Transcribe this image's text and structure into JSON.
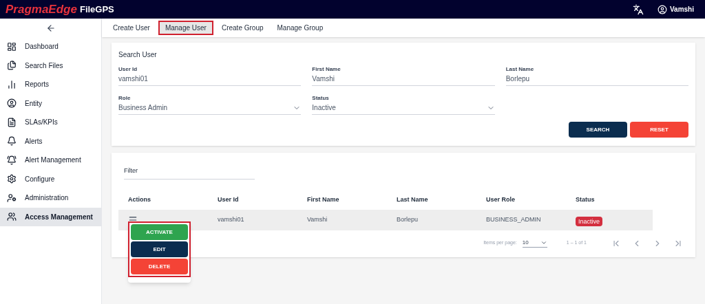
{
  "header": {
    "brand": "PragmaEdge",
    "product": "FileGPS",
    "user": "Vamshi"
  },
  "sidebar": {
    "items": [
      {
        "label": "Dashboard",
        "selected": false
      },
      {
        "label": "Search Files",
        "selected": false
      },
      {
        "label": "Reports",
        "selected": false
      },
      {
        "label": "Entity",
        "selected": false
      },
      {
        "label": "SLAs/KPIs",
        "selected": false
      },
      {
        "label": "Alerts",
        "selected": false
      },
      {
        "label": "Alert Management",
        "selected": false
      },
      {
        "label": "Configure",
        "selected": false
      },
      {
        "label": "Administration",
        "selected": false
      },
      {
        "label": "Access Management",
        "selected": true
      }
    ]
  },
  "tabs": [
    {
      "label": "Create User",
      "selected": false
    },
    {
      "label": "Manage User",
      "selected": true
    },
    {
      "label": "Create Group",
      "selected": false
    },
    {
      "label": "Manage Group",
      "selected": false
    }
  ],
  "search": {
    "title": "Search User",
    "fields": [
      {
        "kind": "text",
        "label": "User Id",
        "value": "vamshi01"
      },
      {
        "kind": "text",
        "label": "First Name",
        "value": "Vamshi"
      },
      {
        "kind": "text",
        "label": "Last Name",
        "value": "Borlepu"
      },
      {
        "kind": "select",
        "label": "Role",
        "value": "Business Admin"
      },
      {
        "kind": "select",
        "label": "Status",
        "value": "Inactive"
      }
    ],
    "buttons": [
      {
        "label": "SEARCH",
        "color": "#0b2d4f"
      },
      {
        "label": "RESET",
        "color": "#f44336"
      }
    ]
  },
  "table": {
    "filter": {
      "placeholder": "Filter"
    },
    "columns": [
      "Actions",
      "User Id",
      "First Name",
      "Last Name",
      "User Role",
      "Status"
    ],
    "rows": [
      {
        "user_id": "vamshi01",
        "first_name": "Vamshi",
        "last_name": "Borlepu",
        "role": "BUSINESS_ADMIN",
        "status": "Inactive"
      }
    ],
    "pagination": {
      "label": "Items per page:",
      "page_size": "10",
      "range": "1 – 1 of 1"
    }
  },
  "action_menu": {
    "items": [
      {
        "label": "ACTIVATE",
        "color": "#2ea44f"
      },
      {
        "label": "EDIT",
        "color": "#0b2d4f"
      },
      {
        "label": "DELETE",
        "color": "#f44336"
      }
    ]
  }
}
